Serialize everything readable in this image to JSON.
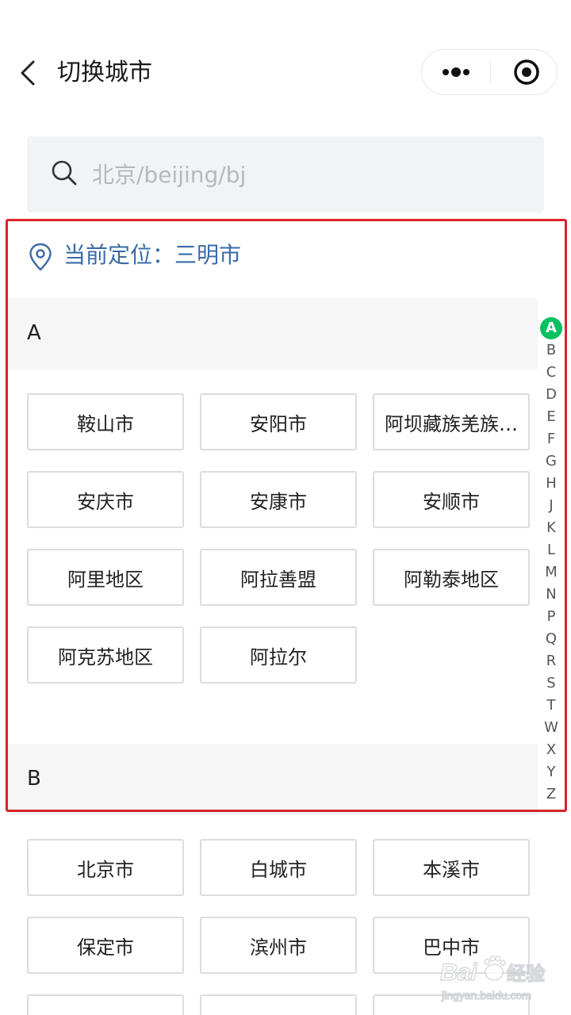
{
  "header": {
    "title": "切换城市"
  },
  "search": {
    "placeholder": "北京/beijing/bj",
    "value": ""
  },
  "location": {
    "text": "当前定位：三明市"
  },
  "sections": [
    {
      "letter": "A",
      "cities": [
        "鞍山市",
        "安阳市",
        "阿坝藏族羌族…",
        "安庆市",
        "安康市",
        "安顺市",
        "阿里地区",
        "阿拉善盟",
        "阿勒泰地区",
        "阿克苏地区",
        "阿拉尔"
      ]
    },
    {
      "letter": "B",
      "cities": [
        "北京市",
        "白城市",
        "本溪市",
        "保定市",
        "滨州市",
        "巴中市"
      ]
    }
  ],
  "index": {
    "letters": [
      "A",
      "B",
      "C",
      "D",
      "E",
      "F",
      "G",
      "H",
      "J",
      "K",
      "L",
      "M",
      "N",
      "P",
      "Q",
      "R",
      "S",
      "T",
      "W",
      "X",
      "Y",
      "Z"
    ],
    "active": "A"
  },
  "colors": {
    "accent": "#07c160",
    "location_blue": "#3a6aa8",
    "highlight_red": "#d8232a"
  },
  "watermark": {
    "text": "Baidu经验",
    "subtext": "jingyan.baidu.com"
  }
}
